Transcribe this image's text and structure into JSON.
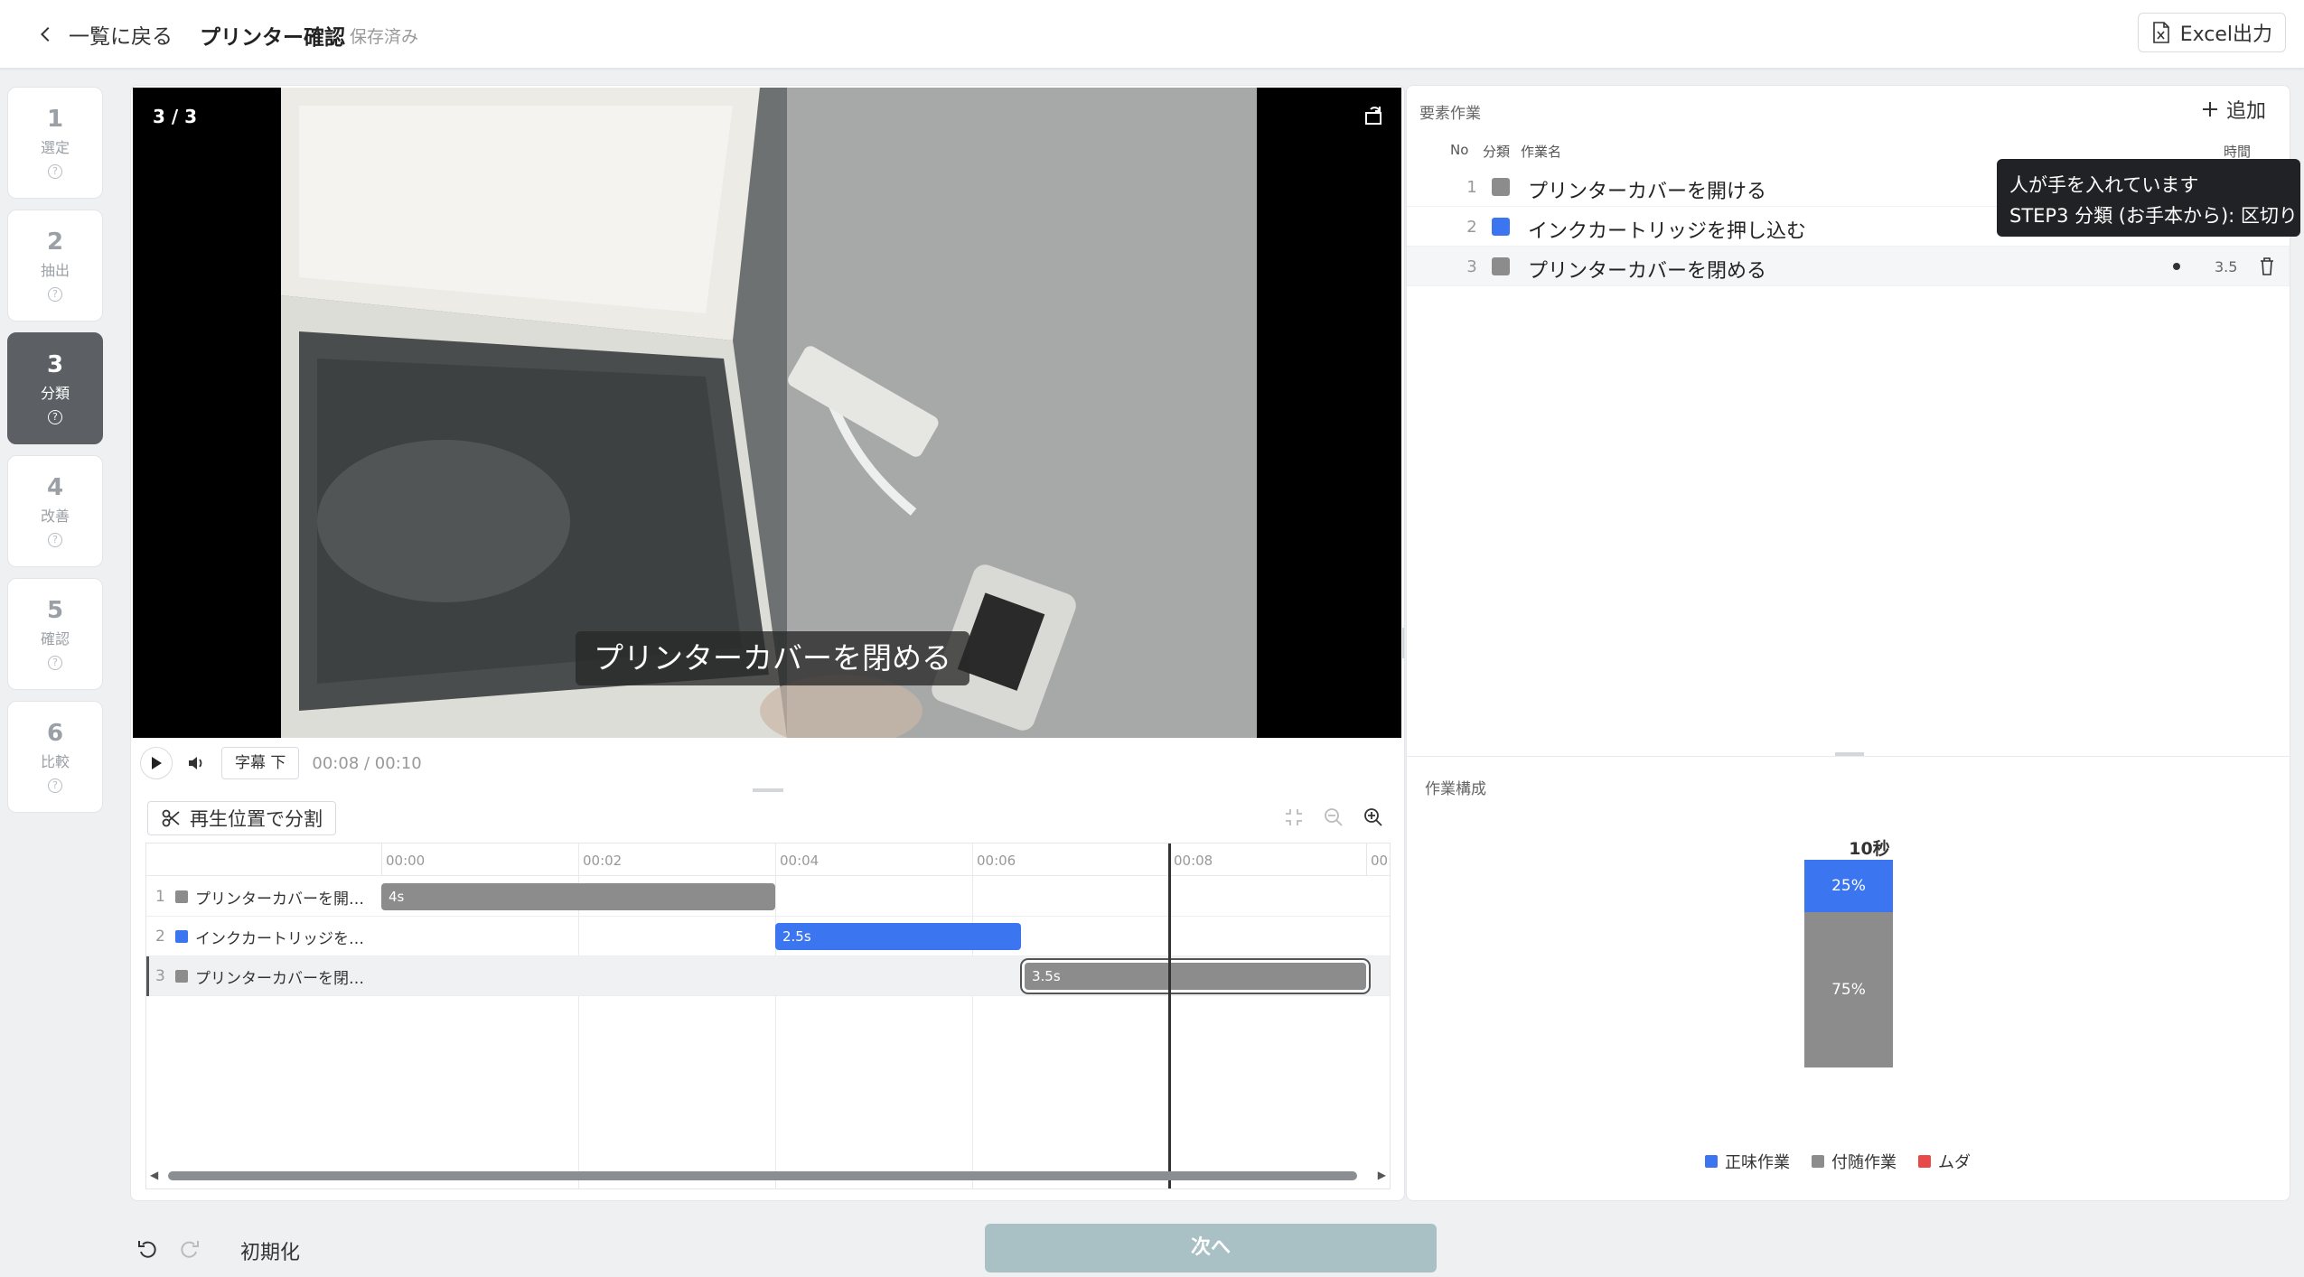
{
  "header": {
    "back_label": "一覧に戻る",
    "title": "プリンター確認",
    "status": "保存済み",
    "excel_label": "Excel出力"
  },
  "steps": [
    {
      "num": "1",
      "label": "選定",
      "active": false
    },
    {
      "num": "2",
      "label": "抽出",
      "active": false
    },
    {
      "num": "3",
      "label": "分類",
      "active": true
    },
    {
      "num": "4",
      "label": "改善",
      "active": false
    },
    {
      "num": "5",
      "label": "確認",
      "active": false
    },
    {
      "num": "6",
      "label": "比較",
      "active": false
    }
  ],
  "video": {
    "counter": "3 / 3",
    "caption": "プリンターカバーを閉める",
    "subtitle_btn": "字幕 下",
    "timecode": "00:08 / 00:10"
  },
  "timeline": {
    "split_label": "再生位置で分割",
    "ticks": [
      "00:00",
      "00:02",
      "00:04",
      "00:06",
      "00:08",
      "00:"
    ],
    "rows": [
      {
        "no": "1",
        "label": "プリンターカバーを開…",
        "bar": "4s",
        "color": "#8c8c8c"
      },
      {
        "no": "2",
        "label": "インクカートリッジを…",
        "bar": "2.5s",
        "color": "#3b76f0"
      },
      {
        "no": "3",
        "label": "プリンターカバーを閉…",
        "bar": "3.5s",
        "color": "#8c8c8c"
      }
    ]
  },
  "elements": {
    "title": "要素作業",
    "add_label": "追加",
    "col_no": "No",
    "col_cat": "分類",
    "col_name": "作業名",
    "col_time": "時間",
    "rows": [
      {
        "no": "1",
        "name": "プリンターカバーを開ける",
        "color": "#8c8c8c",
        "time": ""
      },
      {
        "no": "2",
        "name": "インクカートリッジを押し込む",
        "color": "#3b76f0",
        "time": ""
      },
      {
        "no": "3",
        "name": "プリンターカバーを閉める",
        "color": "#8c8c8c",
        "time": "3.5"
      }
    ]
  },
  "tooltip": {
    "line1": "人が手を入れています",
    "line2": "STEP3 分類 (お手本から): 区切り"
  },
  "composition": {
    "title": "作業構成",
    "legend": [
      {
        "label": "正味作業",
        "color": "#3b76f0"
      },
      {
        "label": "付随作業",
        "color": "#8c8c8c"
      },
      {
        "label": "ムダ",
        "color": "#e84a4a"
      }
    ]
  },
  "chart_data": {
    "type": "bar",
    "categories": [
      "10秒"
    ],
    "series": [
      {
        "name": "正味作業",
        "values": [
          25
        ]
      },
      {
        "name": "付随作業",
        "values": [
          75
        ]
      }
    ],
    "data_labels": [
      "25%",
      "75%"
    ],
    "total_label": "10秒",
    "ylim": [
      0,
      100
    ]
  },
  "footer": {
    "reset_label": "初期化",
    "next_label": "次へ"
  }
}
